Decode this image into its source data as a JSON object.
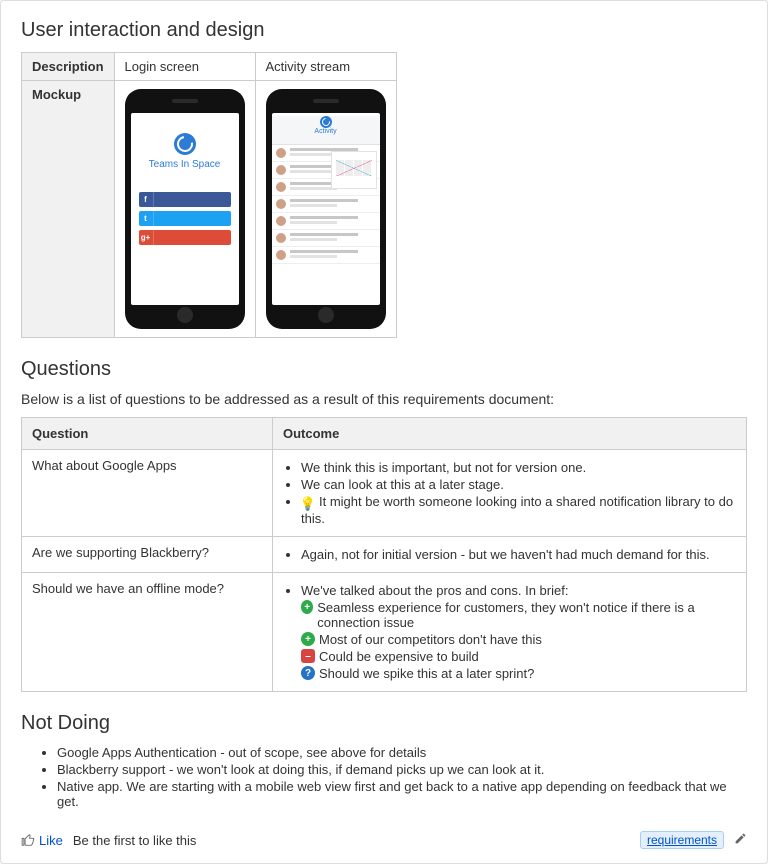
{
  "sections": {
    "ui_design": "User interaction and design",
    "questions": "Questions",
    "not_doing": "Not Doing"
  },
  "design_table": {
    "header_desc": "Description",
    "header_mockup": "Mockup",
    "col_login": "Login screen",
    "col_activity": "Activity stream",
    "login_brand": "Teams In Space",
    "activity_title": "Activity"
  },
  "questions_intro": "Below is a list of questions to be addressed as a result of this requirements document:",
  "q_table": {
    "head_q": "Question",
    "head_o": "Outcome",
    "rows": [
      {
        "q": "What about Google Apps",
        "outcome": [
          {
            "text": "We think this is important, but not for version one."
          },
          {
            "text": "We can look at this at a later stage."
          },
          {
            "icon": "bulb",
            "text": "It might be worth someone looking into a shared notification library to do this."
          }
        ]
      },
      {
        "q": "Are we supporting Blackberry?",
        "outcome": [
          {
            "text": "Again, not for initial version - but we haven't had much demand for this."
          }
        ]
      },
      {
        "q": "Should we have an offline mode?",
        "outcome_lead": "We've talked about the pros and cons. In brief:",
        "outcome": [
          {
            "icon": "plus",
            "text": "Seamless experience for customers, they won't notice if there is a connection issue"
          },
          {
            "icon": "plus",
            "text": "Most of our competitors don't have this"
          },
          {
            "icon": "minus",
            "text": "Could be expensive to build"
          },
          {
            "icon": "q",
            "text": "Should we spike this at a later sprint?"
          }
        ]
      }
    ]
  },
  "not_doing": [
    "Google Apps Authentication - out of scope, see above for details",
    "Blackberry support - we won't look at doing this, if demand picks up we can look at it.",
    "Native app. We are starting with a mobile web view first and get back to a native app depending on feedback that we get."
  ],
  "footer": {
    "like_label": "Like",
    "like_hint": "Be the first to like this",
    "tag": "requirements"
  }
}
